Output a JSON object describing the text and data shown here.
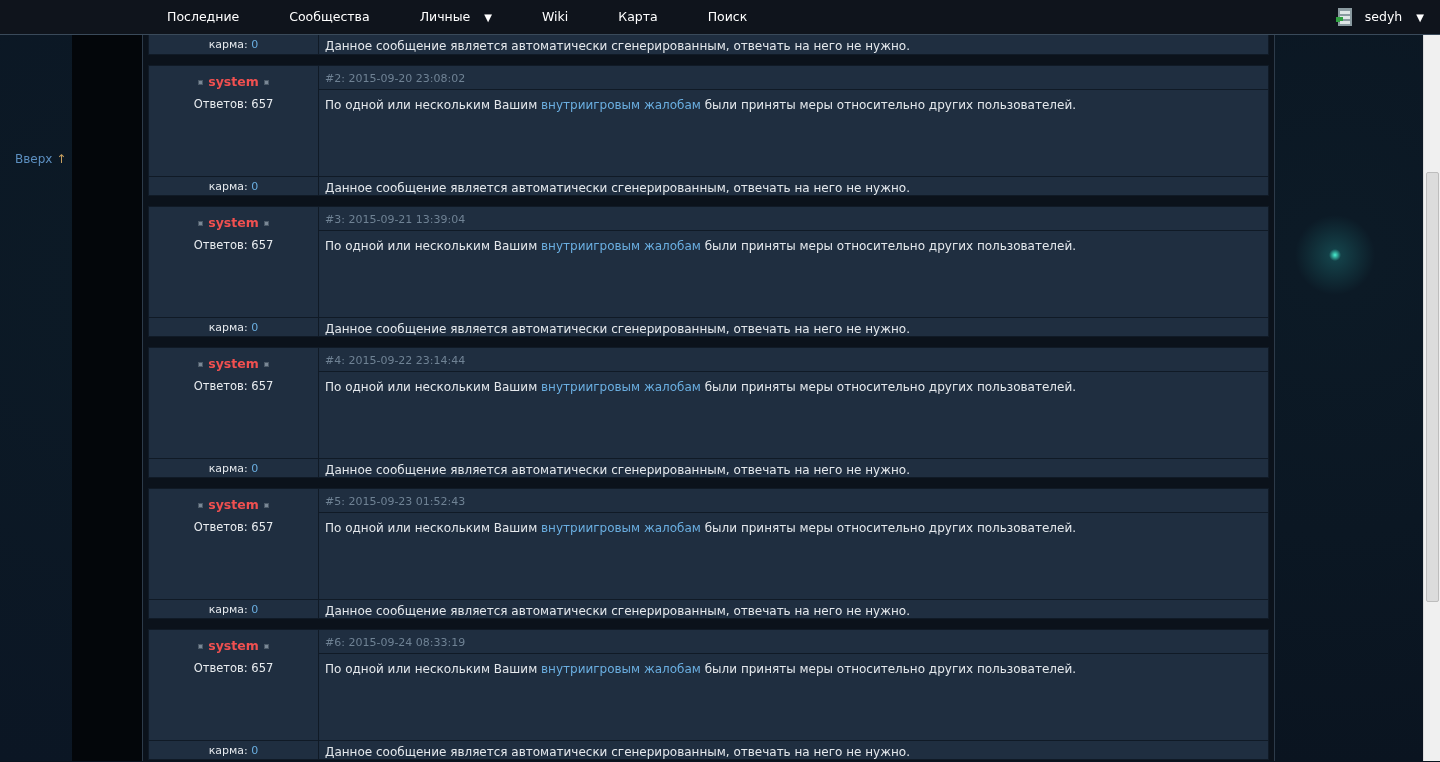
{
  "nav": {
    "items": [
      {
        "label": "Последние"
      },
      {
        "label": "Сообщества"
      },
      {
        "label": "Личные",
        "arrow": "▼"
      },
      {
        "label": "Wiki"
      },
      {
        "label": "Карта"
      },
      {
        "label": "Поиск"
      }
    ],
    "user": {
      "name": "sedyh",
      "arrow": "▼"
    }
  },
  "sidebar": {
    "up_link": "Вверх",
    "up_arrow": "↑"
  },
  "top_footer": {
    "karma_label": "карма:",
    "karma_value": "0",
    "signature": "Данное сообщение является автоматически сгенерированным, отвечать на него не нужно."
  },
  "posts": [
    {
      "header": "#2: 2015-09-20 23:08:02",
      "author": "system",
      "replies": "Ответов: 657",
      "body_before": "По одной или нескольким Вашим",
      "body_link": "внутриигровым жалобам",
      "body_after": "были приняты меры относительно других пользователей.",
      "karma_label": "карма:",
      "karma_value": "0",
      "signature": "Данное сообщение является автоматически сгенерированным, отвечать на него не нужно."
    },
    {
      "header": "#3: 2015-09-21 13:39:04",
      "author": "system",
      "replies": "Ответов: 657",
      "body_before": "По одной или нескольким Вашим",
      "body_link": "внутриигровым жалобам",
      "body_after": "были приняты меры относительно других пользователей.",
      "karma_label": "карма:",
      "karma_value": "0",
      "signature": "Данное сообщение является автоматически сгенерированным, отвечать на него не нужно."
    },
    {
      "header": "#4: 2015-09-22 23:14:44",
      "author": "system",
      "replies": "Ответов: 657",
      "body_before": "По одной или нескольким Вашим",
      "body_link": "внутриигровым жалобам",
      "body_after": "были приняты меры относительно других пользователей.",
      "karma_label": "карма:",
      "karma_value": "0",
      "signature": "Данное сообщение является автоматически сгенерированным, отвечать на него не нужно."
    },
    {
      "header": "#5: 2015-09-23 01:52:43",
      "author": "system",
      "replies": "Ответов: 657",
      "body_before": "По одной или нескольким Вашим",
      "body_link": "внутриигровым жалобам",
      "body_after": "были приняты меры относительно других пользователей.",
      "karma_label": "карма:",
      "karma_value": "0",
      "signature": "Данное сообщение является автоматически сгенерированным, отвечать на него не нужно."
    },
    {
      "header": "#6: 2015-09-24 08:33:19",
      "author": "system",
      "replies": "Ответов: 657",
      "body_before": "По одной или нескольким Вашим",
      "body_link": "внутриигровым жалобам",
      "body_after": "были приняты меры относительно других пользователей.",
      "karma_label": "карма:",
      "karma_value": "0",
      "signature": "Данное сообщение является автоматически сгенерированным, отвечать на него не нужно."
    }
  ]
}
